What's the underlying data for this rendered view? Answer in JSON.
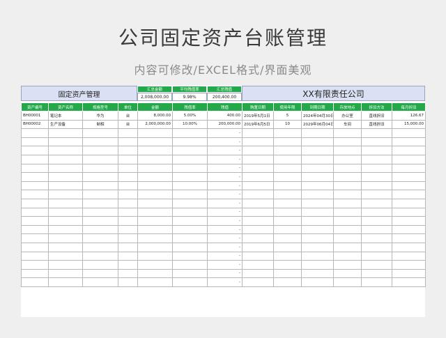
{
  "page": {
    "title": "公司固定资产台账管理",
    "subtitle": "内容可修改/EXCEL格式/界面美观"
  },
  "sheet_header": {
    "left_title": "固定资产管理",
    "company": "XX有限责任公司",
    "summary": [
      {
        "label": "汇总金额",
        "value": "2,008,000.00"
      },
      {
        "label": "平均残值率",
        "value": "9.98%"
      },
      {
        "label": "汇总残值",
        "value": "200,400.00"
      }
    ]
  },
  "table": {
    "columns": [
      "资产编号",
      "资产名称",
      "规格型号",
      "单位",
      "金额",
      "残值率",
      "残值",
      "购置日期",
      "使用年限",
      "到期日期",
      "存放地点",
      "折旧方法",
      "每月折旧"
    ],
    "rows": [
      [
        "BH00001",
        "笔记本",
        "华为",
        "台",
        "8,000.00",
        "5.00%",
        "400.00",
        "2019年5月1日",
        "5",
        "2024年04月30日",
        "办公室",
        "直线折旧",
        "126.67"
      ],
      [
        "BH00002",
        "生产设备",
        "制相",
        "台",
        "2,000,000.00",
        "10.00%",
        "200,000.00",
        "2019年6月5日",
        "10",
        "2029年06月04日",
        "车间",
        "直线折旧",
        "15,000.00"
      ],
      [
        "",
        "",
        "",
        "",
        "",
        "",
        "-",
        "",
        "",
        "",
        "",
        "",
        ""
      ],
      [
        "",
        "",
        "",
        "",
        "",
        "",
        "-",
        "",
        "",
        "",
        "",
        "",
        ""
      ],
      [
        "",
        "",
        "",
        "",
        "",
        "",
        "-",
        "",
        "",
        "",
        "",
        "",
        ""
      ],
      [
        "",
        "",
        "",
        "",
        "",
        "",
        "-",
        "",
        "",
        "",
        "",
        "",
        ""
      ],
      [
        "",
        "",
        "",
        "",
        "",
        "",
        "-",
        "",
        "",
        "",
        "",
        "",
        ""
      ],
      [
        "",
        "",
        "",
        "",
        "",
        "",
        "-",
        "",
        "",
        "",
        "",
        "",
        ""
      ],
      [
        "",
        "",
        "",
        "",
        "",
        "",
        "-",
        "",
        "",
        "",
        "",
        "",
        ""
      ],
      [
        "",
        "",
        "",
        "",
        "",
        "",
        "-",
        "",
        "",
        "",
        "",
        "",
        ""
      ],
      [
        "",
        "",
        "",
        "",
        "",
        "",
        "-",
        "",
        "",
        "",
        "",
        "",
        ""
      ],
      [
        "",
        "",
        "",
        "",
        "",
        "",
        "-",
        "",
        "",
        "",
        "",
        "",
        ""
      ],
      [
        "",
        "",
        "",
        "",
        "",
        "",
        "-",
        "",
        "",
        "",
        "",
        "",
        ""
      ],
      [
        "",
        "",
        "",
        "",
        "",
        "",
        "-",
        "",
        "",
        "",
        "",
        "",
        ""
      ],
      [
        "",
        "",
        "",
        "",
        "",
        "",
        "-",
        "",
        "",
        "",
        "",
        "",
        ""
      ],
      [
        "",
        "",
        "",
        "",
        "",
        "",
        "-",
        "",
        "",
        "",
        "",
        "",
        ""
      ],
      [
        "",
        "",
        "",
        "",
        "",
        "",
        "-",
        "",
        "",
        "",
        "",
        "",
        ""
      ],
      [
        "",
        "",
        "",
        "",
        "",
        "",
        "-",
        "",
        "",
        "",
        "",
        "",
        ""
      ],
      [
        "",
        "",
        "",
        "",
        "",
        "",
        "-",
        "",
        "",
        "",
        "",
        "",
        ""
      ],
      [
        "",
        "",
        "",
        "",
        "",
        "",
        "-",
        "",
        "",
        "",
        "",
        "",
        ""
      ]
    ]
  }
}
